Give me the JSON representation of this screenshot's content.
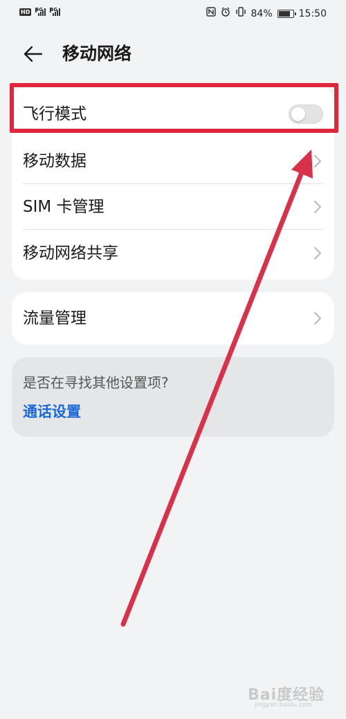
{
  "status_bar": {
    "hd_label": "HD",
    "network_1": "4G",
    "network_2": "4G",
    "battery_percent": "84%",
    "battery_level": 0.84,
    "time": "15:50",
    "icons": [
      "nfc-icon",
      "alarm-icon",
      "vibrate-icon",
      "battery-icon"
    ]
  },
  "header": {
    "title": "移动网络",
    "back_icon": "back-arrow-icon"
  },
  "settings": {
    "airplane_mode": {
      "label": "飞行模式",
      "enabled": false
    },
    "mobile_data": {
      "label": "移动数据"
    },
    "sim_management": {
      "label": "SIM 卡管理"
    },
    "hotspot": {
      "label": "移动网络共享"
    },
    "data_usage": {
      "label": "流量管理"
    }
  },
  "hint": {
    "question": "是否在寻找其他设置项?",
    "link": "通话设置"
  },
  "colors": {
    "accent_link": "#1a68d6",
    "annotation_red": "#e0263c",
    "background": "#f1f3f5"
  },
  "watermark": {
    "text": "Bai度经验",
    "sub": "jingyan.baidu.com"
  }
}
